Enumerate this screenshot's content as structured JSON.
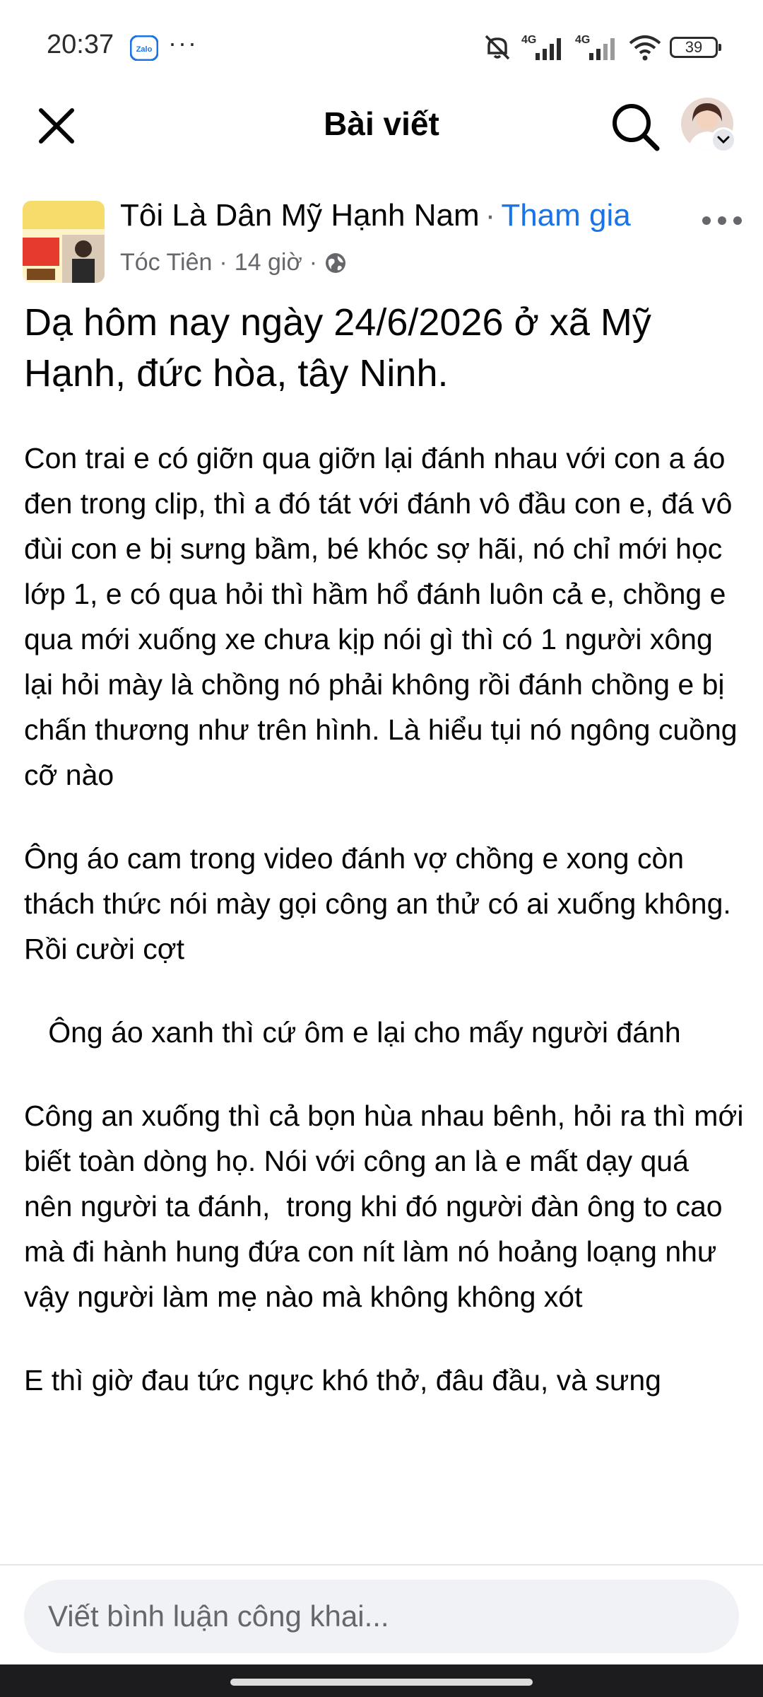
{
  "status_bar": {
    "time": "20:37",
    "zalo_label": "Zalo",
    "more_dots": "···",
    "network_1": "4G",
    "network_2": "4G",
    "battery": "39"
  },
  "header": {
    "title": "Bài viết",
    "close_icon": "close-icon",
    "search_icon": "search-icon"
  },
  "post": {
    "group_name": "Tôi Là Dân Mỹ Hạnh Nam",
    "separator": "·",
    "join_label": "Tham gia",
    "author": "Tóc Tiên",
    "meta_separator": "·",
    "time": "14 giờ",
    "audience_icon": "globe-icon",
    "title": "Dạ hôm nay ngày 24/6/2026 ở xã Mỹ Hạnh, đức hòa, tây Ninh.",
    "paragraphs": [
      "Con trai e có giỡn qua giỡn lại đánh nhau với con a áo đen trong clip, thì a đó tát với đánh vô đầu con e, đá vô đùi con e bị sưng bầm, bé khóc sợ hãi, nó chỉ mới học lớp 1, e có qua hỏi thì hầm hổ đánh luôn cả e, chồng e qua mới xuống xe chưa kịp nói gì thì có 1 người xông lại hỏi mày là chồng nó phải không rồi đánh chồng e bị chấn thương như trên hình. Là hiểu tụi nó ngông cuồng cỡ nào",
      "Ông áo cam trong video đánh vợ chồng e xong còn thách thức nói mày gọi công an thử có ai xuống không. Rồi cười cợt",
      "   Ông áo xanh thì cứ ôm e lại cho mấy người đánh",
      "Công an xuống thì cả bọn hùa nhau bênh, hỏi ra thì mới biết toàn dòng họ. Nói với công an là e mất dạy quá nên người ta đánh,  trong khi đó người đàn ông to cao mà đi hành hung đứa con nít làm nó hoảng loạng như vậy người làm mẹ nào mà không không xót",
      "E thì giờ đau tức ngực khó thở, đâu đầu, và sưng"
    ]
  },
  "comment": {
    "placeholder": "Viết bình luận công khai..."
  },
  "colors": {
    "link": "#1b74e4",
    "text": "#050505",
    "secondary_text": "#65676b",
    "input_bg": "#f0f2f5",
    "nav_bar": "#1c1c1e"
  }
}
